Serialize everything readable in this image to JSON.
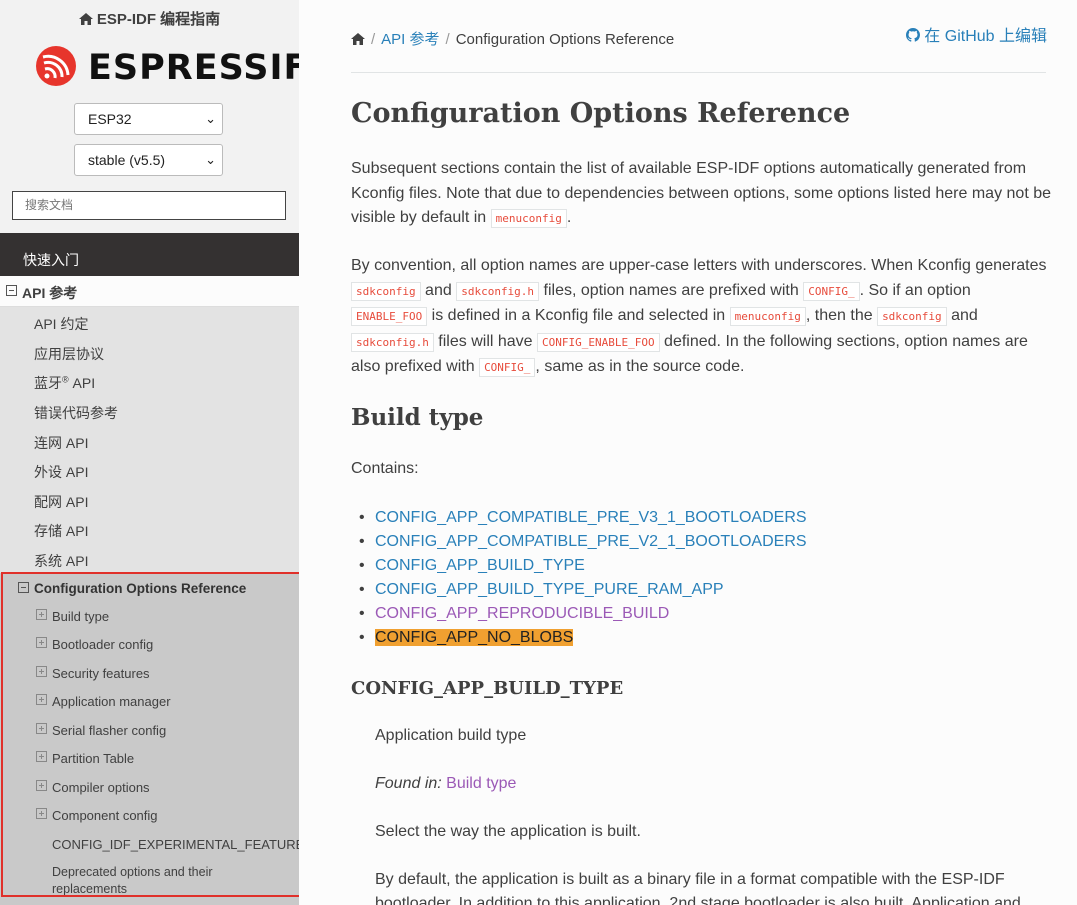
{
  "sidebar": {
    "home_label": "ESP-IDF 编程指南",
    "logo_text": "ESPRESSIF",
    "target_select": "ESP32",
    "version_select": "stable (v5.5)",
    "search_placeholder": "搜索文档",
    "quick_start": "快速入门",
    "api_reference": "API 参考",
    "api_items": [
      "API 约定",
      "应用层协议",
      "蓝牙",
      "错误代码参考",
      "连网 API",
      "外设 API",
      "配网 API",
      "存储 API",
      "系统 API"
    ],
    "bluetooth_suffix": "API",
    "registered_mark": "®",
    "config_ref": "Configuration Options Reference",
    "config_items": [
      "Build type",
      "Bootloader config",
      "Security features",
      "Application manager",
      "Serial flasher config",
      "Partition Table",
      "Compiler options",
      "Component config"
    ],
    "config_experimental": "CONFIG_IDF_EXPERIMENTAL_FEATURES",
    "config_deprecated": "Deprecated options and their replacements"
  },
  "breadcrumb": {
    "api": "API 参考",
    "current": "Configuration Options Reference"
  },
  "github_link": "在 GitHub 上编辑",
  "content": {
    "title": "Configuration Options Reference",
    "p1_a": "Subsequent sections contain the list of available ESP-IDF options automatically generated from Kconfig files. Note that due to dependencies between options, some options listed here may not be visible by default in ",
    "p1_code": "menuconfig",
    "p1_b": ".",
    "p2": {
      "t1": "By convention, all option names are upper-case letters with underscores. When Kconfig generates ",
      "c1": "sdkconfig",
      "t2": " and ",
      "c2": "sdkconfig.h",
      "t3": " files, option names are prefixed with ",
      "c3": "CONFIG_",
      "t4": ". So if an option ",
      "c4": "ENABLE_FOO",
      "t5": " is defined in a Kconfig file and selected in ",
      "c5": "menuconfig",
      "t6": ", then the ",
      "c6": "sdkconfig",
      "t7": " and ",
      "c7": "sdkconfig.h",
      "t8": " files will have ",
      "c8": "CONFIG_ENABLE_FOO",
      "t9": " defined. In the following sections, option names are also prefixed with ",
      "c9": "CONFIG_",
      "t10": ", same as in the source code."
    },
    "section_title": "Build type",
    "contains": "Contains:",
    "options": [
      "CONFIG_APP_COMPATIBLE_PRE_V3_1_BOOTLOADERS",
      "CONFIG_APP_COMPATIBLE_PRE_V2_1_BOOTLOADERS",
      "CONFIG_APP_BUILD_TYPE",
      "CONFIG_APP_BUILD_TYPE_PURE_RAM_APP",
      "CONFIG_APP_REPRODUCIBLE_BUILD",
      "CONFIG_APP_NO_BLOBS"
    ],
    "option_title": "CONFIG_APP_BUILD_TYPE",
    "dd1": "Application build type",
    "found_in_label": "Found in:",
    "found_in_link": "Build type",
    "dd3": "Select the way the application is built.",
    "dd4": "By default, the application is built as a binary file in a format compatible with the ESP-IDF bootloader. In addition to this application, 2nd stage bootloader is also built. Application and"
  },
  "colors": {
    "link": "#2980b9",
    "visited": "#9b59b6",
    "highlight": "#f0a030",
    "code": "#e74c3c",
    "annotation_border": "#e0302a"
  }
}
